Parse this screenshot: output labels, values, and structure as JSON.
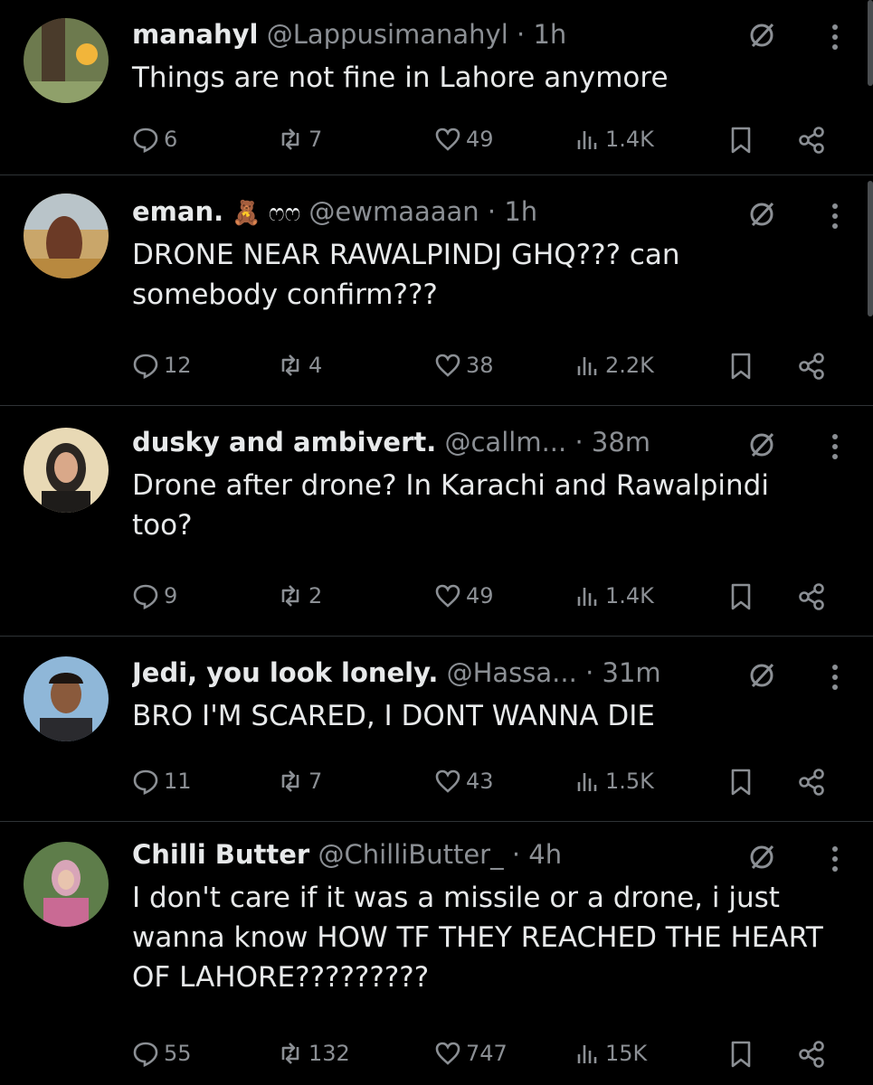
{
  "posts": [
    {
      "name": "manahyl",
      "handle": "@Lappusimanahyl",
      "time": "1h",
      "text": "Things are not fine in Lahore anymore",
      "replies": "6",
      "reposts": "7",
      "likes": "49",
      "views": "1.4K"
    },
    {
      "name": "eman.",
      "name_emoji": "🧸 ෆෆ",
      "handle": "@ewmaaaan",
      "time": "1h",
      "text": "DRONE NEAR RAWALPINDJ GHQ??? can somebody confirm???",
      "replies": "12",
      "reposts": "4",
      "likes": "38",
      "views": "2.2K"
    },
    {
      "name": "dusky and ambivert.",
      "handle": "@callm...",
      "time": "38m",
      "text": "Drone after drone? In Karachi and Rawalpindi too?",
      "replies": "9",
      "reposts": "2",
      "likes": "49",
      "views": "1.4K"
    },
    {
      "name": "Jedi, you look lonely.",
      "handle": "@Hassa...",
      "time": "31m",
      "text": "BRO I'M SCARED, I DONT WANNA DIE",
      "replies": "11",
      "reposts": "7",
      "likes": "43",
      "views": "1.5K"
    },
    {
      "name": "Chilli Butter",
      "handle": "@ChilliButter_",
      "time": "4h",
      "text": "I don't care if it was a missile or a drone, i just wanna know HOW TF THEY REACHED THE HEART OF LAHORE?????????",
      "replies": "55",
      "reposts": "132",
      "likes": "747",
      "views": "15K"
    }
  ],
  "separator": "·",
  "icons": {
    "reply": "reply-icon",
    "repost": "repost-icon",
    "like": "heart-icon",
    "views": "views-icon",
    "bookmark": "bookmark-icon",
    "share": "share-icon",
    "grok": "grok-icon",
    "more": "more-icon"
  },
  "colors": {
    "background": "#000000",
    "text": "#e7e9ea",
    "muted": "#8b8f94",
    "divider": "#2f3336"
  }
}
